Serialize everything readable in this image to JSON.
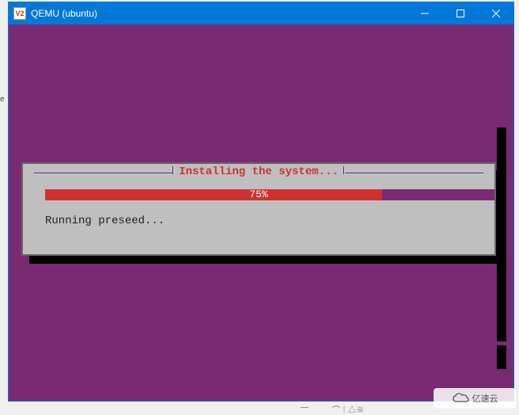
{
  "titlebar": {
    "icon_text": "V2",
    "title": "QEMU (ubuntu)"
  },
  "installer": {
    "dialog_title": "Installing the system...",
    "progress_percent": 75,
    "progress_label": "75%",
    "status_text": "Running preseed..."
  },
  "watermark": {
    "text": "亿速云"
  }
}
